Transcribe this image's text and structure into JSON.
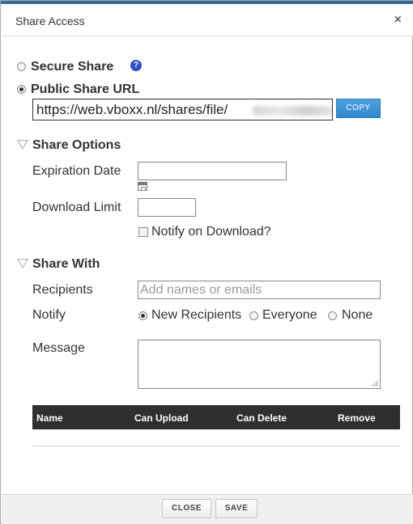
{
  "dialog": {
    "title": "Share Access",
    "close_glyph": "×"
  },
  "share_type": {
    "secure_label": "Secure Share",
    "secure_selected": false,
    "help_glyph": "?",
    "public_label": "Public Share URL",
    "public_selected": true,
    "url_value": "https://web.vboxx.nl/shares/file/",
    "copy_label": "COPY"
  },
  "share_options": {
    "heading": "Share Options",
    "expiration_label": "Expiration Date",
    "expiration_value": "",
    "download_limit_label": "Download Limit",
    "download_limit_value": "",
    "notify_download_label": "Notify on Download?",
    "notify_download_checked": false
  },
  "share_with": {
    "heading": "Share With",
    "recipients_label": "Recipients",
    "recipients_placeholder": "Add names or emails",
    "notify_label": "Notify",
    "notify_options": [
      {
        "label": "New Recipients",
        "selected": true
      },
      {
        "label": "Everyone",
        "selected": false
      },
      {
        "label": "None",
        "selected": false
      }
    ],
    "message_label": "Message",
    "message_value": ""
  },
  "table": {
    "columns": [
      "Name",
      "Can Upload",
      "Can Delete",
      "Remove"
    ],
    "rows": []
  },
  "footer": {
    "close_label": "CLOSE",
    "save_label": "SAVE"
  },
  "colors": {
    "accent": "#3188cf",
    "help_icon": "#2f52c7",
    "table_header": "#2f2f2f"
  },
  "icons": [
    "close-icon",
    "help-icon",
    "calendar-icon",
    "collapse-triangle-icon",
    "resize-grip-icon"
  ]
}
